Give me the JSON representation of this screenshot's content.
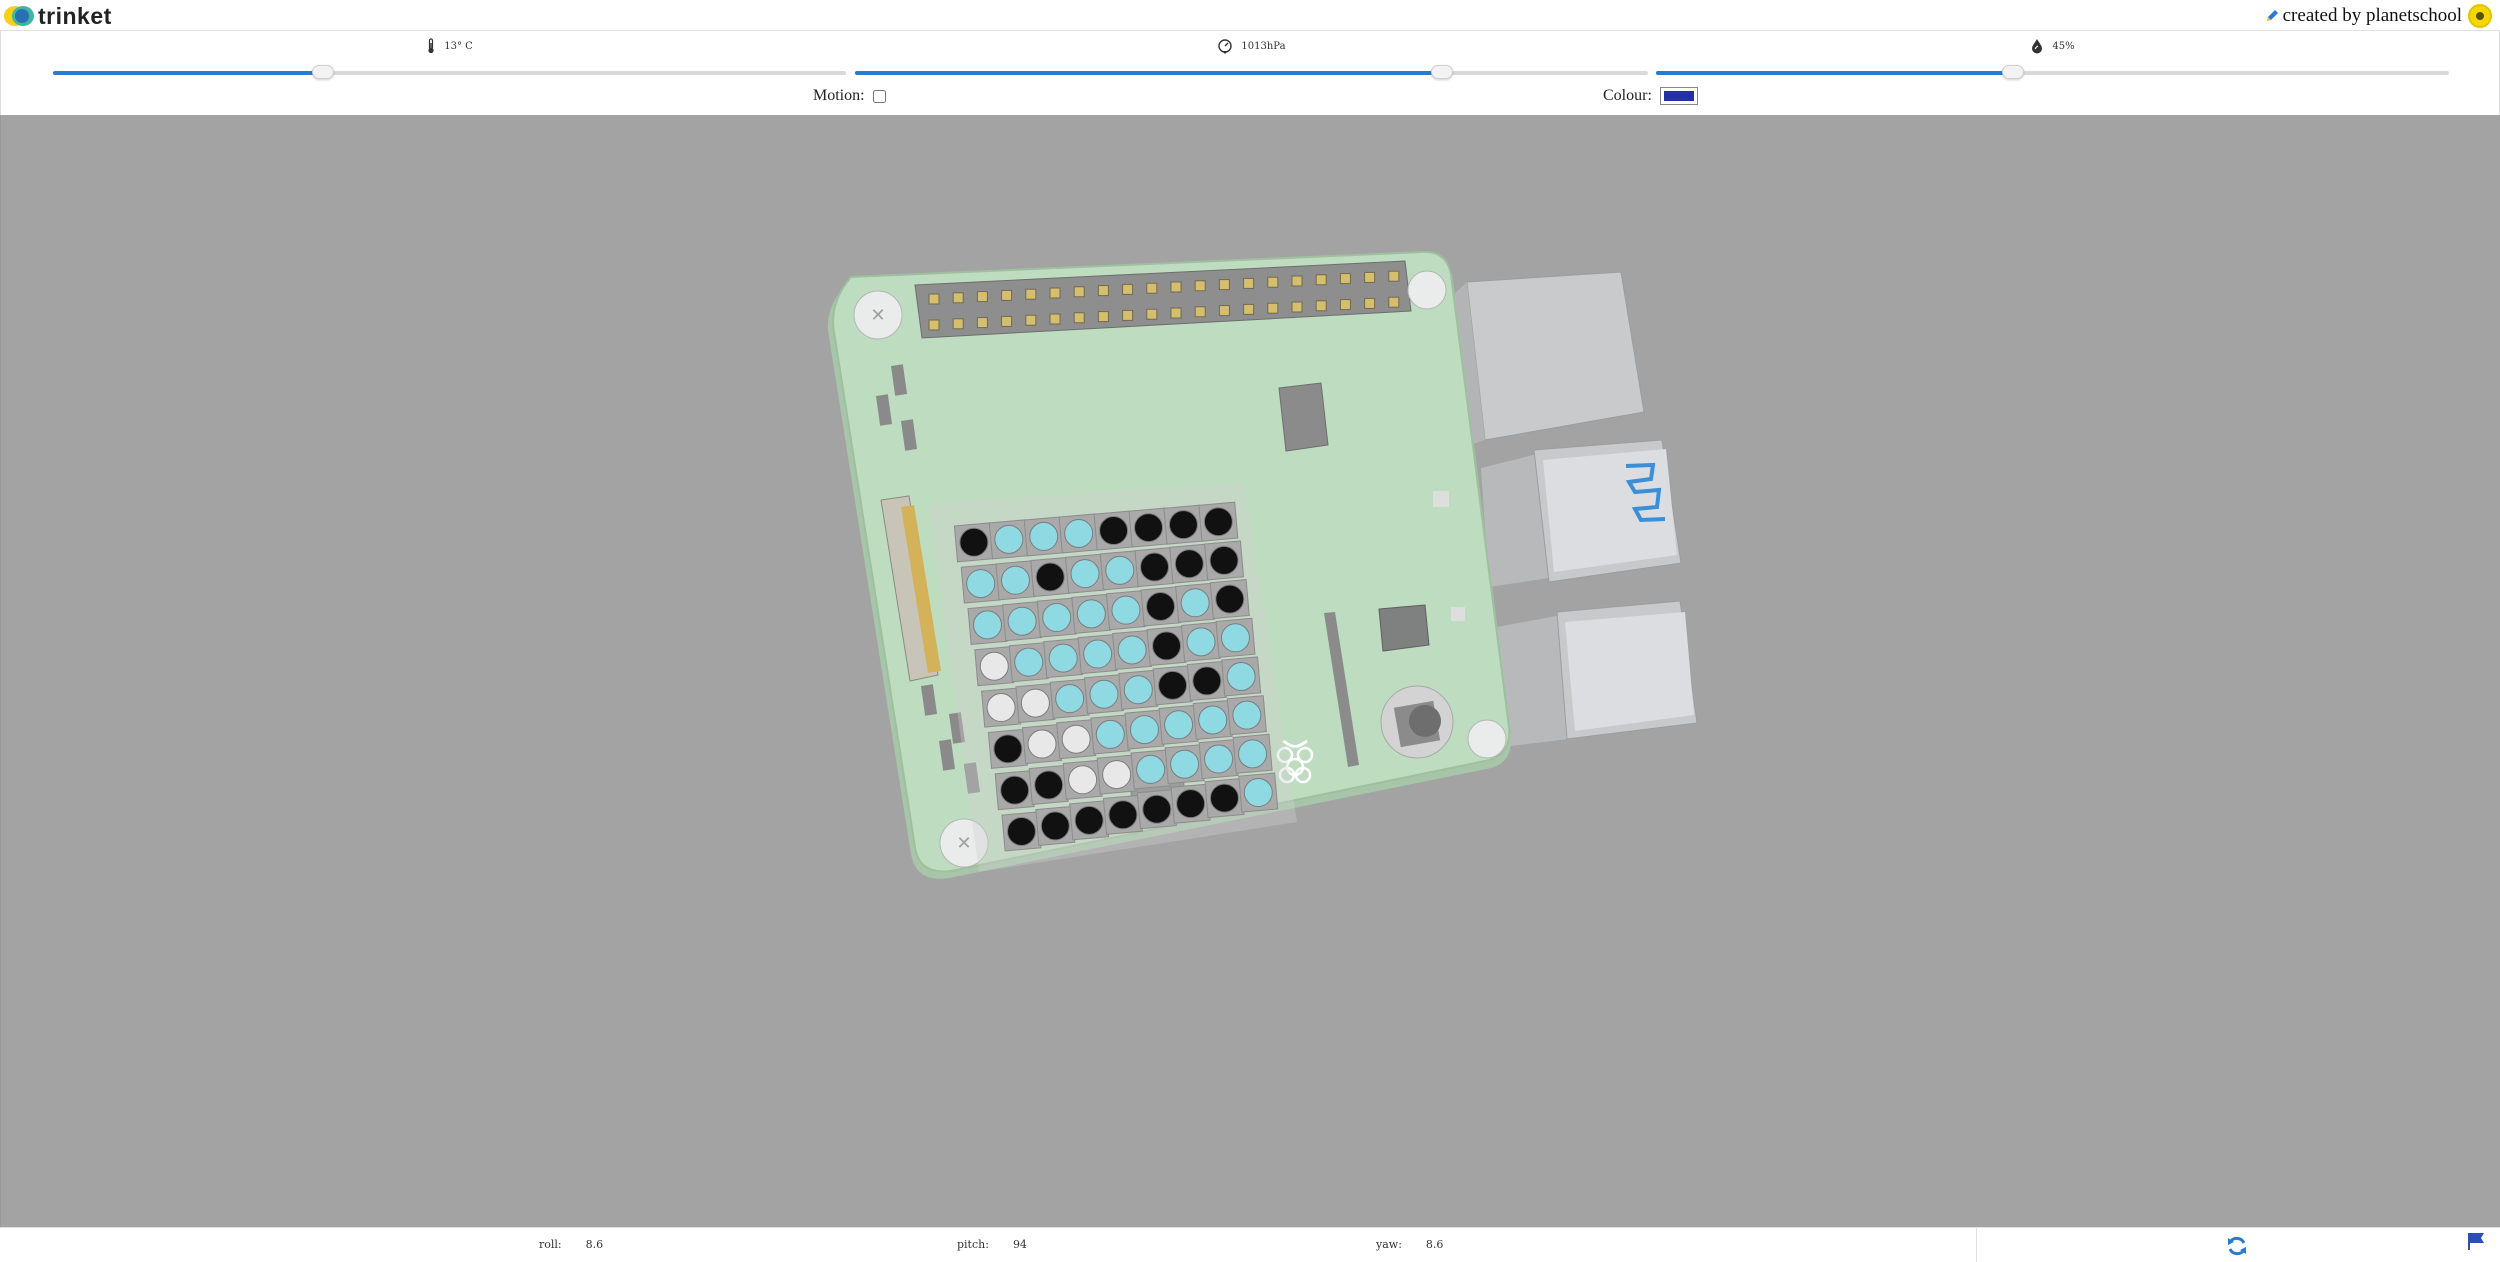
{
  "header": {
    "brand": "trinket",
    "created_by": "created by planetschool"
  },
  "sensors": {
    "temperature": {
      "label": "13° C",
      "value_fraction": 0.34,
      "icon": "thermometer-icon"
    },
    "pressure": {
      "label": "1013hPa",
      "value_fraction": 0.74,
      "icon": "pressure-gauge-icon"
    },
    "humidity": {
      "label": "45%",
      "value_fraction": 0.45,
      "icon": "humidity-drop-icon"
    }
  },
  "motion": {
    "label": "Motion:",
    "checked": false
  },
  "colour": {
    "label": "Colour:",
    "value": "#2430a6"
  },
  "orientation": {
    "roll_label": "roll:",
    "roll": "8.6",
    "pitch_label": "pitch:",
    "pitch": "94",
    "yaw_label": "yaw:",
    "yaw": "8.6"
  },
  "colors": {
    "accent": "#2a7ad5",
    "canvas_bg": "#a3a3a3",
    "board_green": "#bedcbf",
    "led_cyan": "#8fd9e3",
    "led_black": "#111111",
    "led_white": "#e8e8e8"
  },
  "led_matrix": [
    [
      "k",
      "c",
      "c",
      "c",
      "k",
      "k",
      "k",
      "k"
    ],
    [
      "c",
      "c",
      "k",
      "c",
      "c",
      "k",
      "k",
      "k"
    ],
    [
      "c",
      "c",
      "c",
      "c",
      "c",
      "k",
      "c",
      "k"
    ],
    [
      "w",
      "c",
      "c",
      "c",
      "c",
      "k",
      "c",
      "c"
    ],
    [
      "w",
      "w",
      "c",
      "c",
      "c",
      "k",
      "k",
      "c"
    ],
    [
      "k",
      "w",
      "w",
      "c",
      "c",
      "c",
      "c",
      "c"
    ],
    [
      "k",
      "k",
      "w",
      "w",
      "c",
      "c",
      "c",
      "c"
    ],
    [
      "k",
      "k",
      "k",
      "k",
      "k",
      "k",
      "k",
      "c"
    ]
  ]
}
